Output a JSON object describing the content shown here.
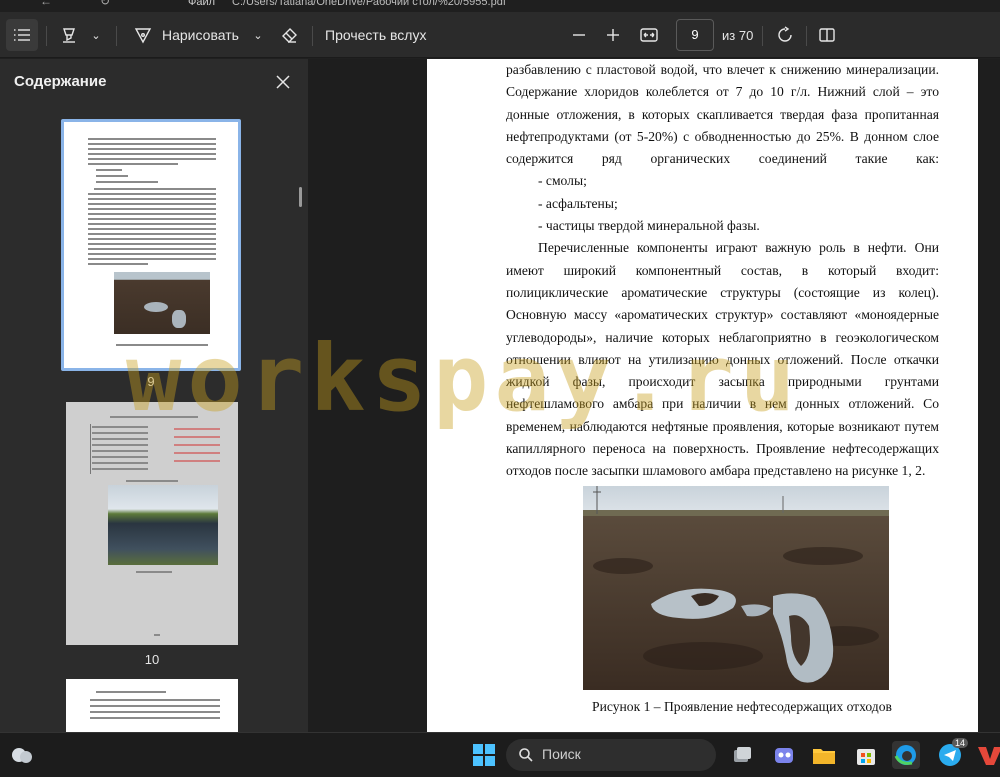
{
  "window": {
    "title": "Файл",
    "path": "C:/Users/Tatiana/OneDrive/Рабочий стол/%20/5955.pdf"
  },
  "toolbar": {
    "draw_label": "Нарисовать",
    "read_aloud_label": "Прочесть вслух",
    "page_current": "9",
    "page_total": "из 70",
    "icons": [
      "contents-icon",
      "highlight-icon",
      "draw-icon",
      "eraser-icon",
      "zoom-out-icon",
      "zoom-in-icon",
      "fit-width-icon",
      "rotate-icon",
      "two-page-icon"
    ]
  },
  "sidebar": {
    "title": "Содержание",
    "thumbs": [
      {
        "number": "9",
        "selected": true
      },
      {
        "number": "10",
        "selected": false
      }
    ]
  },
  "document": {
    "paragraph1": "разбавлению с пластовой водой, что влечет к снижению минерализации. Содержание хлоридов колеблется от 7 до 10 г/л. Нижний слой – это донные отложения, в которых скапливается твердая фаза пропитанная нефтепродуктами (от 5-20%) с обводненностью до 25%. В донном слое содержится ряд органических соединений такие как:",
    "list": [
      "- смолы;",
      "- асфальтены;",
      "- частицы твердой минеральной фазы."
    ],
    "paragraph2": "Перечисленные компоненты играют важную роль в нефти. Они имеют широкий компонентный состав, в который входит: полициклические ароматические структуры (состоящие из колец). Основную массу «ароматических структур» составляют «моноядерные углеводороды», наличие которых неблагоприятно в геоэкологическом отношении влияют на утилизацию донных отложений. После откачки жидкой фазы, происходит засыпка природными грунтами нефтешламового амбара при наличии в нем донных отложений. Со временем, наблюдаются нефтяные проявления, которые возникают путем капиллярного переноса на поверхность. Проявление нефтесодержащих отходов после засыпки шламового амбара представлено на рисунке 1, 2.",
    "caption": "Рисунок 1 – Проявление нефтесодержащих отходов"
  },
  "watermark": "workspay.ru",
  "taskbar": {
    "search_label": "Поиск",
    "telegram_badge": "14"
  },
  "colors": {
    "accent": "#8ab4e8",
    "watermark": "#c8a01e"
  }
}
